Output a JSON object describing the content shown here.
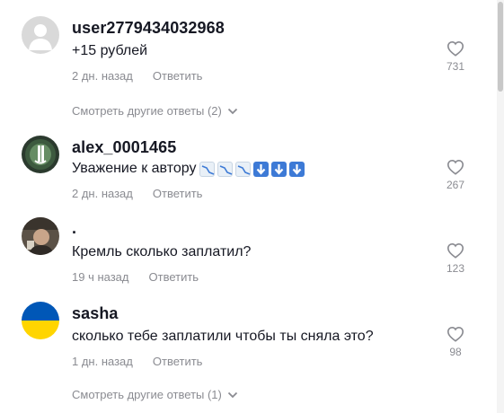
{
  "comments": [
    {
      "username": "user2779434032968",
      "text": "+15 рублей",
      "time": "2 дн. назад",
      "reply_label": "Ответить",
      "likes": "731",
      "more_replies": "Смотреть другие ответы (2)",
      "avatar": "default-avatar-icon"
    },
    {
      "username": "alex_0001465",
      "text": "Уважение к автору",
      "emojis": [
        "chart-decreasing-icon",
        "chart-decreasing-icon",
        "chart-decreasing-icon",
        "down-arrow-icon",
        "down-arrow-icon",
        "down-arrow-icon"
      ],
      "time": "2 дн. назад",
      "reply_label": "Ответить",
      "likes": "267",
      "avatar": "juventus-logo-avatar"
    },
    {
      "username": ".",
      "text": "Кремль сколько заплатил?",
      "time": "19 ч назад",
      "reply_label": "Ответить",
      "likes": "123",
      "avatar": "photo-avatar"
    },
    {
      "username": "sasha",
      "text": "сколько тебе заплатили чтобы ты сняла это?",
      "time": "1 дн. назад",
      "reply_label": "Ответить",
      "likes": "98",
      "more_replies": "Смотреть другие ответы (1)",
      "avatar": "ukraine-flag-avatar"
    }
  ],
  "colors": {
    "text": "#161823",
    "secondary": "#8a8b91",
    "flag_blue": "#0057b7",
    "flag_yellow": "#ffd500"
  }
}
